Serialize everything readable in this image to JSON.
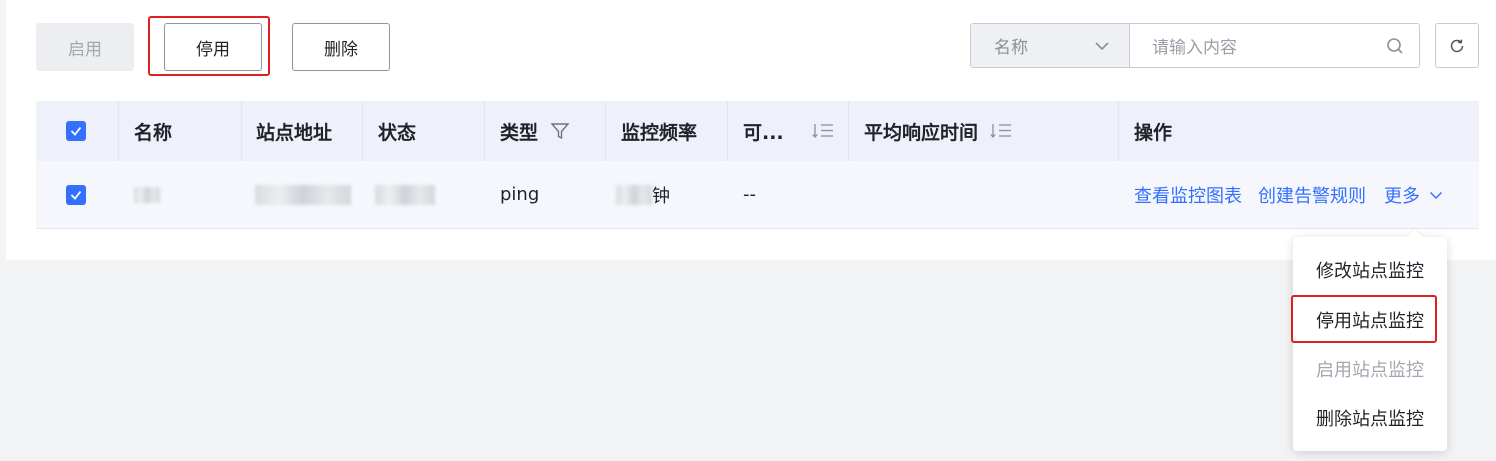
{
  "toolbar": {
    "enable_label": "启用",
    "disable_label": "停用",
    "delete_label": "删除"
  },
  "search": {
    "field_selected": "名称",
    "placeholder": "请输入内容"
  },
  "table": {
    "columns": {
      "name": "名称",
      "url": "站点地址",
      "status": "状态",
      "type": "类型",
      "frequency": "监控频率",
      "availability": "可...",
      "avg_response": "平均响应时间",
      "actions": "操作"
    },
    "rows": [
      {
        "type": "ping",
        "frequency_suffix": "钟",
        "availability": "--",
        "action_view_chart": "查看监控图表",
        "action_create_alert": "创建告警规则",
        "action_more": "更多"
      }
    ]
  },
  "more_menu": {
    "items": [
      {
        "label": "修改站点监控",
        "disabled": false
      },
      {
        "label": "停用站点监控",
        "disabled": false
      },
      {
        "label": "启用站点监控",
        "disabled": true
      },
      {
        "label": "删除站点监控",
        "disabled": false
      }
    ]
  },
  "colors": {
    "accent": "#3370ff",
    "highlight": "#e02020",
    "header_bg": "#eef1fa",
    "row_bg": "#f5f7fc"
  }
}
